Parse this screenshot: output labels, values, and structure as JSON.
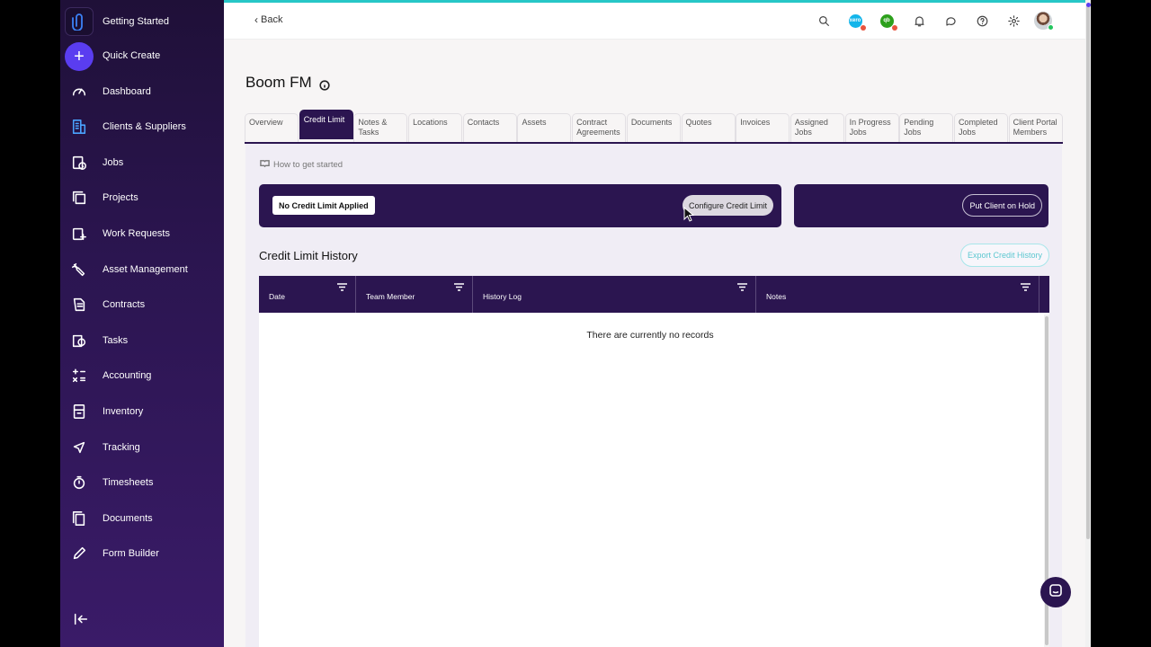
{
  "sidebar": {
    "items": [
      {
        "label": "Getting Started",
        "icon": "paperclip-logo-icon"
      },
      {
        "label": "Quick Create",
        "icon": "plus-icon"
      },
      {
        "label": "Dashboard",
        "icon": "gauge-icon"
      },
      {
        "label": "Clients & Suppliers",
        "icon": "building-icon"
      },
      {
        "label": "Jobs",
        "icon": "clipboard-clock-icon"
      },
      {
        "label": "Projects",
        "icon": "stacked-pages-icon"
      },
      {
        "label": "Work Requests",
        "icon": "clipboard-plus-icon"
      },
      {
        "label": "Asset Management",
        "icon": "wrench-icon"
      },
      {
        "label": "Contracts",
        "icon": "contract-icon"
      },
      {
        "label": "Tasks",
        "icon": "task-clock-icon"
      },
      {
        "label": "Accounting",
        "icon": "calculator-icon"
      },
      {
        "label": "Inventory",
        "icon": "inventory-icon"
      },
      {
        "label": "Tracking",
        "icon": "location-arrow-icon"
      },
      {
        "label": "Timesheets",
        "icon": "stopwatch-icon"
      },
      {
        "label": "Documents",
        "icon": "documents-icon"
      },
      {
        "label": "Form Builder",
        "icon": "pencil-icon"
      }
    ],
    "collapse_icon": "collapse-left-icon"
  },
  "topbar": {
    "back_label": "Back",
    "xero_label": "xero",
    "qb_label": "qb",
    "colors": {
      "accent_top": "#27c7c7",
      "xero": "#13b5ea",
      "quickbooks": "#2ca01c",
      "alert_dot": "#e8543e"
    }
  },
  "page": {
    "title": "Boom FM"
  },
  "tabs": [
    {
      "label": "Overview",
      "active": false
    },
    {
      "label": "Credit Limit",
      "active": true
    },
    {
      "label": "Notes & Tasks",
      "active": false
    },
    {
      "label": "Locations",
      "active": false
    },
    {
      "label": "Contacts",
      "active": false
    },
    {
      "label": "Assets",
      "active": false
    },
    {
      "label": "Contract Agreements",
      "active": false
    },
    {
      "label": "Documents",
      "active": false
    },
    {
      "label": "Quotes",
      "active": false
    },
    {
      "label": "Invoices",
      "active": false
    },
    {
      "label": "Assigned Jobs",
      "active": false
    },
    {
      "label": "In Progress Jobs",
      "active": false
    },
    {
      "label": "Pending Jobs",
      "active": false
    },
    {
      "label": "Completed Jobs",
      "active": false
    },
    {
      "label": "Client Portal Members",
      "active": false
    }
  ],
  "credit_limit": {
    "how_to_label": "How to get started",
    "status_badge": "No Credit Limit Applied",
    "configure_button": "Configure Credit Limit",
    "hold_button": "Put Client on Hold",
    "history_title": "Credit Limit History",
    "export_button": "Export Credit History",
    "columns": [
      "Date",
      "Team Member",
      "History Log",
      "Notes"
    ],
    "empty_message": "There are currently no records"
  },
  "theme": {
    "primary": "#2b1550",
    "brand_purple": "#5a3df0",
    "export_teal": "#5cc7d0"
  }
}
